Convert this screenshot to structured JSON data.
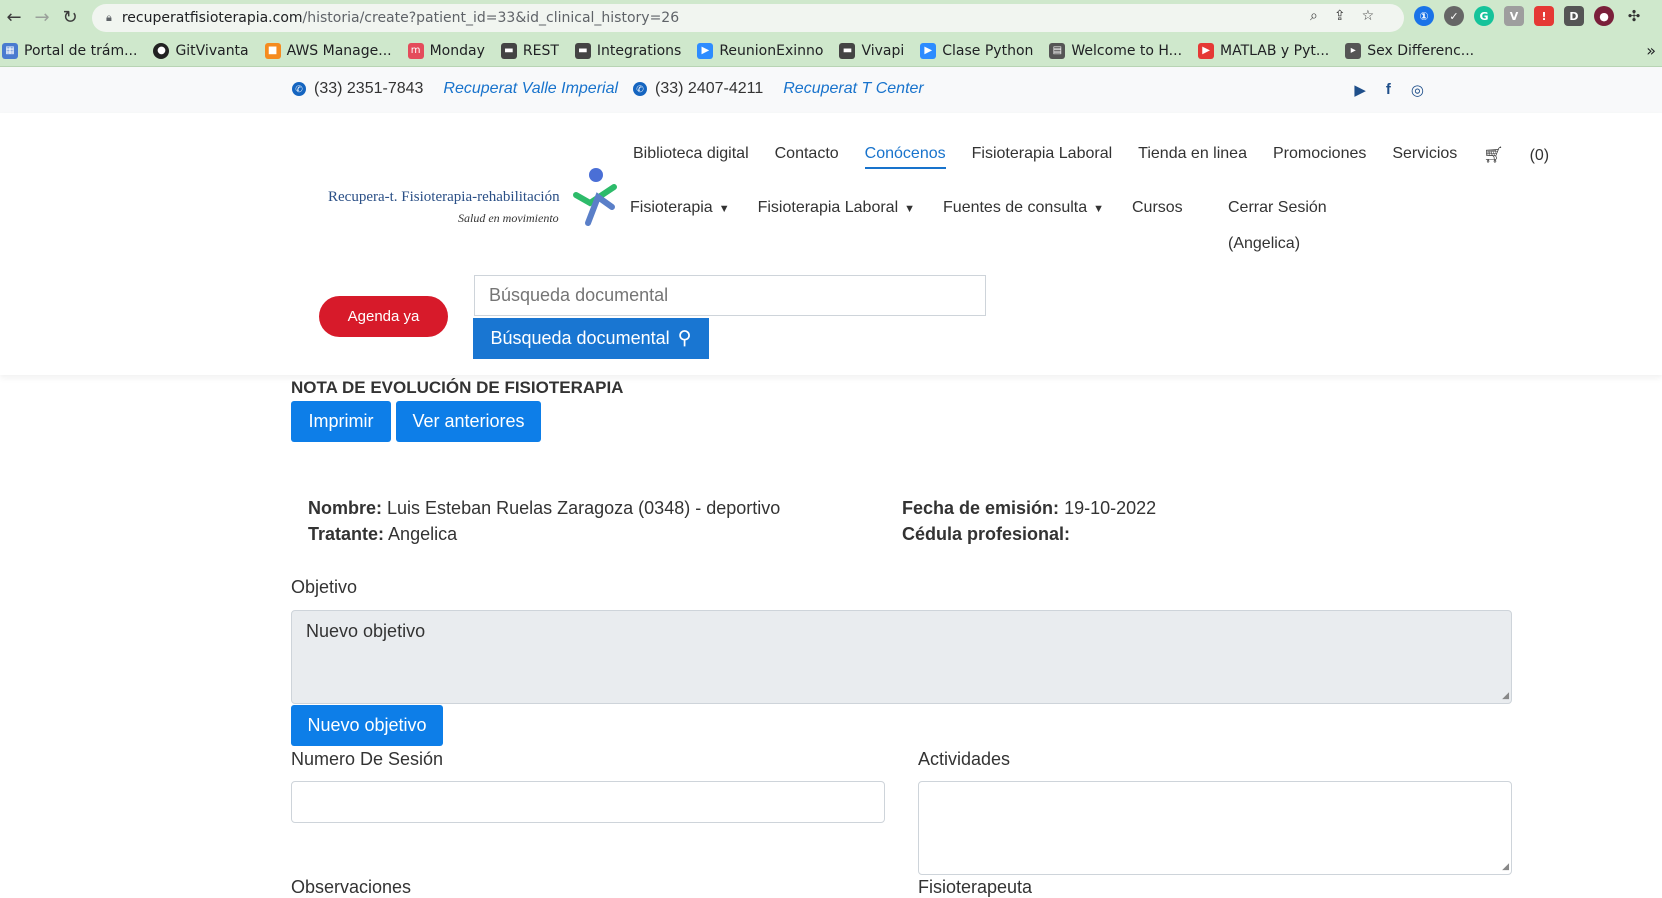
{
  "browser": {
    "url_host": "recuperatfisioterapia.com",
    "url_path": "/historia/create?patient_id=33&id_clinical_history=26",
    "bookmarks": [
      {
        "label": "Portal de trám...",
        "color": "#4a7bd0"
      },
      {
        "label": "GitVivanta",
        "color": "#222222"
      },
      {
        "label": "AWS Manage...",
        "color": "#f58b1f"
      },
      {
        "label": "Monday",
        "color": "#e44c5b"
      },
      {
        "label": "REST",
        "color": "#444444"
      },
      {
        "label": "Integrations",
        "color": "#444444"
      },
      {
        "label": "ReunionExinno",
        "color": "#2d8cff"
      },
      {
        "label": "Vivapi",
        "color": "#444444"
      },
      {
        "label": "Clase Python",
        "color": "#2d8cff"
      },
      {
        "label": "Welcome to H...",
        "color": "#555555"
      },
      {
        "label": "MATLAB y Pyt...",
        "color": "#e53935"
      },
      {
        "label": "Sex Differenc...",
        "color": "#555555"
      }
    ],
    "more": "»"
  },
  "topbar": {
    "phone1": "(33) 2351-7843",
    "branch1": "Recuperat Valle Imperial",
    "phone2": "(33) 2407-4211",
    "branch2": "Recuperat T Center"
  },
  "header": {
    "logo_text": "Recupera-t. Fisioterapia-rehabilitación",
    "logo_sub": "Salud en movimiento",
    "menu1": [
      "Biblioteca digital",
      "Contacto",
      "Conócenos",
      "Fisioterapia Laboral",
      "Tienda en linea",
      "Promociones",
      "Servicios"
    ],
    "cart": "(0)",
    "menu2": [
      "Fisioterapia",
      "Fisioterapia Laboral",
      "Fuentes de consulta",
      "Cursos"
    ],
    "logout_line1": "Cerrar Sesión",
    "logout_line2": "(Angelica)",
    "agenda": "Agenda ya",
    "search_placeholder": "Búsqueda documental",
    "search_button": "Búsqueda documental"
  },
  "note": {
    "title": "NOTA DE EVOLUCIÓN DE FISIOTERAPIA",
    "print": "Imprimir",
    "previous": "Ver anteriores",
    "name_label": "Nombre:",
    "name_value": "Luis Esteban Ruelas Zaragoza (0348) - deportivo",
    "treating_label": "Tratante:",
    "treating_value": "Angelica",
    "date_label": "Fecha de emisión:",
    "date_value": "19-10-2022",
    "license_label": "Cédula profesional:",
    "objective_label": "Objetivo",
    "objective_value": "Nuevo objetivo",
    "new_objective_button": "Nuevo objetivo",
    "session_label": "Numero De Sesión",
    "activities_label": "Actividades",
    "observations_label": "Observaciones",
    "physio_label": "Fisioterapeuta"
  }
}
